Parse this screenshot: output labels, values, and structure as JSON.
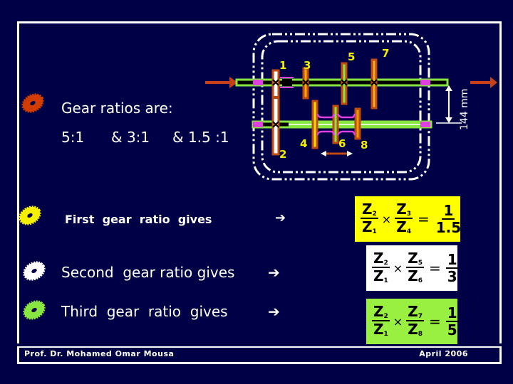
{
  "slide": {
    "heading": "Gear ratios are:",
    "ratios_line": [
      "5:1",
      "& 3:1",
      "& 1.5 :1"
    ],
    "items": [
      {
        "label": "First  gear  ratio  gives",
        "bullet_color": "#F5F000",
        "arrow": "➔"
      },
      {
        "label": "Second  gear ratio gives",
        "bullet_color": "#FFFFFF",
        "arrow": "➔"
      },
      {
        "label": "Third  gear  ratio  gives",
        "bullet_color": "#88E640",
        "arrow": "➔"
      }
    ],
    "heading_bullet_color": "#D23C00"
  },
  "formulas": [
    {
      "n1": "Z",
      "s1": "2",
      "d1": "Z",
      "t1": "1",
      "n2": "Z",
      "s2": "3",
      "d2": "Z",
      "t2": "4",
      "rn": "1",
      "rd": "1.5",
      "bg": "#FFFF00"
    },
    {
      "n1": "Z",
      "s1": "2",
      "d1": "Z",
      "t1": "1",
      "n2": "Z",
      "s2": "5",
      "d2": "Z",
      "t2": "6",
      "rn": "1",
      "rd": "3",
      "bg": "#FFFFFF"
    },
    {
      "n1": "Z",
      "s1": "2",
      "d1": "Z",
      "t1": "1",
      "n2": "Z",
      "s2": "7",
      "d2": "Z",
      "t2": "8",
      "rn": "1",
      "rd": "5",
      "bg": "#99F040"
    }
  ],
  "diagram": {
    "gear_labels": [
      "1",
      "2",
      "3",
      "4",
      "5",
      "6",
      "7",
      "8"
    ],
    "dimension_label": "144 mm"
  },
  "footer": {
    "author": "Prof. Dr. Mohamed Omar Mousa",
    "date": "April 2006"
  },
  "colors": {
    "background": "#000046",
    "shaft": "#88E640",
    "gear_rim": "#C04A10",
    "bearing": "#E040E0",
    "label": "#F5F000"
  }
}
